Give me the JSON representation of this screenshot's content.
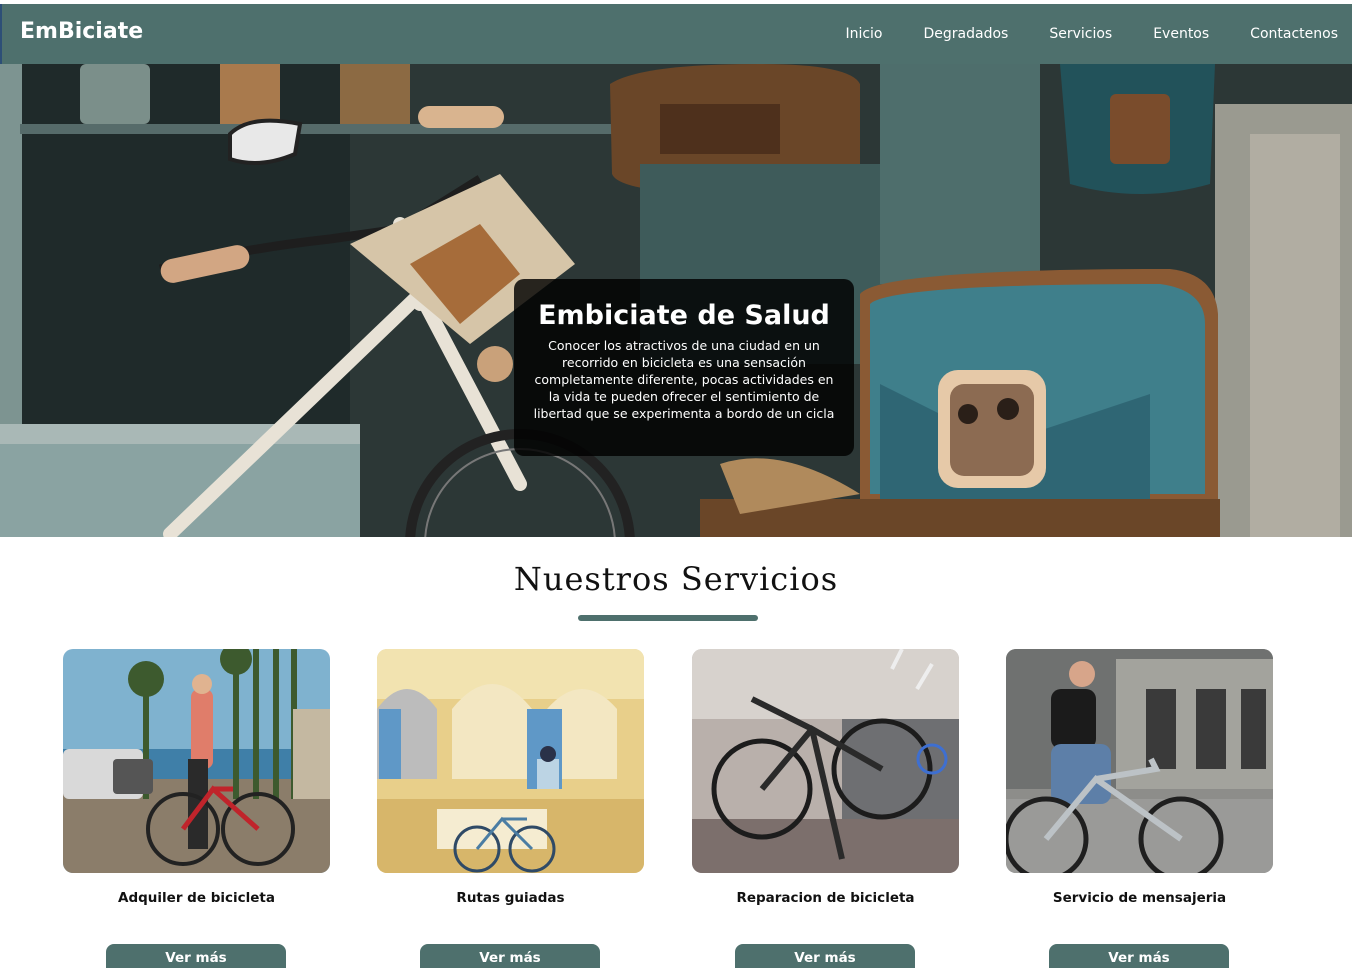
{
  "navbar": {
    "brand": "EmBiciate",
    "links": [
      "Inicio",
      "Degradados",
      "Servicios",
      "Eventos",
      "Contactenos"
    ]
  },
  "hero": {
    "title": "Embiciate de Salud",
    "text": "Conocer los atractivos de una ciudad en un recorrido en bicicleta es una sensación completamente diferente, pocas actividades en la vida te pueden ofrecer el sentimiento de libertad que se experimenta a bordo de un cicla"
  },
  "services": {
    "title": "Nuestros Servicios",
    "button_label": "Ver más",
    "cards": [
      {
        "title": "Adquiler de bicicleta"
      },
      {
        "title": "Rutas guiadas"
      },
      {
        "title": "Reparacion de bicicleta"
      },
      {
        "title": "Servicio de mensajeria"
      }
    ]
  },
  "colors": {
    "nav": "#4e706d",
    "caption_bg": "rgba(0,0,0,0.82)",
    "accent": "#4e706d"
  }
}
